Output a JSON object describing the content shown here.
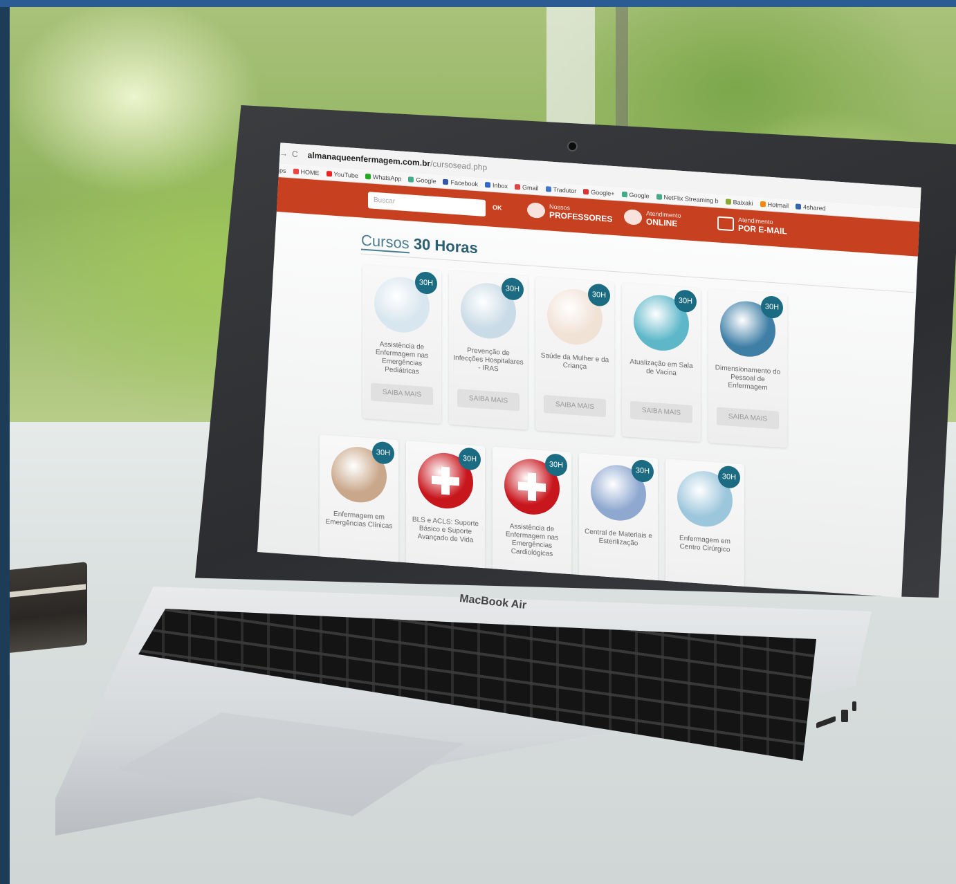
{
  "browser": {
    "url_host": "almanaqueenfermagem.com.br",
    "url_path": "/cursosead.php",
    "bookmarks": [
      "Apps",
      "HOME",
      "YouTube",
      "WhatsApp",
      "Google",
      "Facebook",
      "Inbox",
      "Gmail",
      "Tradutor",
      "Google+",
      "Google",
      "NetFlix Streaming b",
      "Baixaki",
      "Hotmail",
      "4shared"
    ]
  },
  "header": {
    "search_placeholder": "Buscar",
    "ok_label": "OK",
    "professores_small": "Nossos",
    "professores_big": "PROFESSORES",
    "online_small": "Atendimento",
    "online_big": "ONLINE",
    "email_small": "Atendimento",
    "email_big": "POR E-MAIL"
  },
  "page": {
    "title_thin": "Cursos",
    "title_bold": "30 Horas"
  },
  "courses": [
    {
      "badge": "30H",
      "title": "Assistência de Enfermagem nas Emergências Pediátricas",
      "button": "SAIBA MAIS",
      "color": "#d8e6ef"
    },
    {
      "badge": "30H",
      "title": "Prevenção de Infecções Hospitalares - IRAS",
      "button": "SAIBA MAIS",
      "color": "#c9dbe6"
    },
    {
      "badge": "30H",
      "title": "Saúde da Mulher e da Criança",
      "button": "SAIBA MAIS",
      "color": "#f1e2d6"
    },
    {
      "badge": "30H",
      "title": "Atualização em Sala de Vacina",
      "button": "SAIBA MAIS",
      "color": "#5db7c9"
    },
    {
      "badge": "30H",
      "title": "Dimensionamento do Pessoal de Enfermagem",
      "button": "SAIBA MAIS",
      "color": "#3f7fa6"
    },
    {
      "badge": "30H",
      "title": "Enfermagem em Emergências Clínicas",
      "button": "",
      "color": "#c9a78a"
    },
    {
      "badge": "30H",
      "title": "BLS e ACLS: Suporte Básico e Suporte Avançado de Vida",
      "button": "",
      "color": "#c8161d"
    },
    {
      "badge": "30H",
      "title": "Assistência de Enfermagem nas Emergências Cardiológicas",
      "button": "",
      "color": "#c8161d"
    },
    {
      "badge": "30H",
      "title": "Central de Materiais e Esterilização",
      "button": "",
      "color": "#8fa8d0"
    },
    {
      "badge": "30H",
      "title": "Enfermagem em Centro Cirúrgico",
      "button": "",
      "color": "#9cc6dc"
    }
  ],
  "laptop": {
    "brand": "MacBook Air"
  }
}
